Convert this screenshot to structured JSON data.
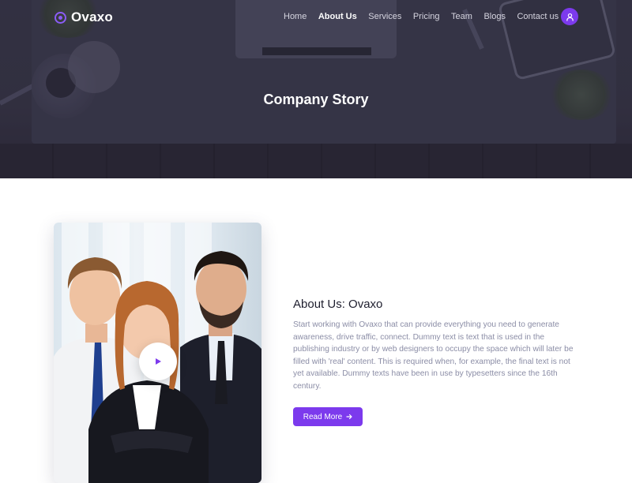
{
  "brand": {
    "name": "Ovaxo"
  },
  "nav": {
    "items": [
      {
        "label": "Home",
        "active": false
      },
      {
        "label": "About Us",
        "active": true
      },
      {
        "label": "Services",
        "active": false
      },
      {
        "label": "Pricing",
        "active": false
      },
      {
        "label": "Team",
        "active": false
      },
      {
        "label": "Blogs",
        "active": false
      },
      {
        "label": "Contact us",
        "active": false
      }
    ],
    "user_icon": "user-icon"
  },
  "hero": {
    "title": "Company Story"
  },
  "about": {
    "title": "About Us: Ovaxo",
    "text": "Start working with Ovaxo that can provide everything you need to generate awareness, drive traffic, connect. Dummy text is text that is used in the publishing industry or by web designers to occupy the space which will later be filled with 'real' content. This is required when, for example, the final text is not yet available. Dummy texts have been in use by typesetters since the 16th century.",
    "button_label": "Read More",
    "button_icon": "arrow-right-icon",
    "play_icon": "play-icon"
  },
  "colors": {
    "accent": "#7c3aed",
    "hero_overlay": "#3a3848",
    "muted_text": "#8b8da6"
  }
}
